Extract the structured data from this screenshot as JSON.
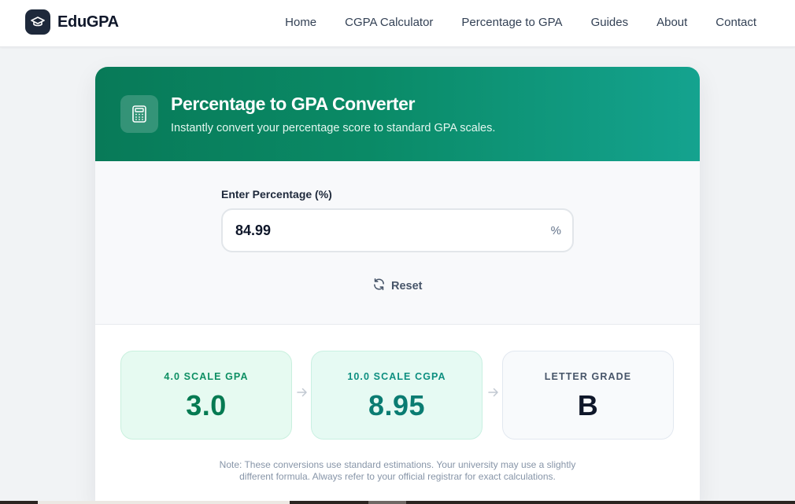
{
  "brand": {
    "name": "EduGPA",
    "logo_icon": "graduation-cap-icon"
  },
  "nav": {
    "items": [
      {
        "label": "Home"
      },
      {
        "label": "CGPA Calculator"
      },
      {
        "label": "Percentage to GPA"
      },
      {
        "label": "Guides"
      },
      {
        "label": "About"
      },
      {
        "label": "Contact"
      }
    ]
  },
  "converter": {
    "icon": "calculator-icon",
    "title": "Percentage to GPA Converter",
    "subtitle": "Instantly convert your percentage score to standard GPA scales.",
    "input_label": "Enter Percentage (%)",
    "input_value": "84.99",
    "input_suffix": "%",
    "reset_label": "Reset",
    "reset_icon": "refresh-icon"
  },
  "results": [
    {
      "label": "4.0 SCALE GPA",
      "value": "3.0",
      "label_color": "#0d8f63",
      "value_color": "#057a52"
    },
    {
      "label": "10.0 SCALE CGPA",
      "value": "8.95",
      "label_color": "#0d8f80",
      "value_color": "#0a7c72"
    },
    {
      "label": "LETTER GRADE",
      "value": "B",
      "label_color": "#475569",
      "value_color": "#0f172a"
    }
  ],
  "note": {
    "line1": "Note: These conversions use standard estimations. Your university may use a slightly",
    "line2": "different formula. Always refer to your official registrar for exact calculations."
  },
  "colors": {
    "accent_start": "#087a58",
    "accent_end": "#14a38f",
    "nav_text": "#334155"
  }
}
